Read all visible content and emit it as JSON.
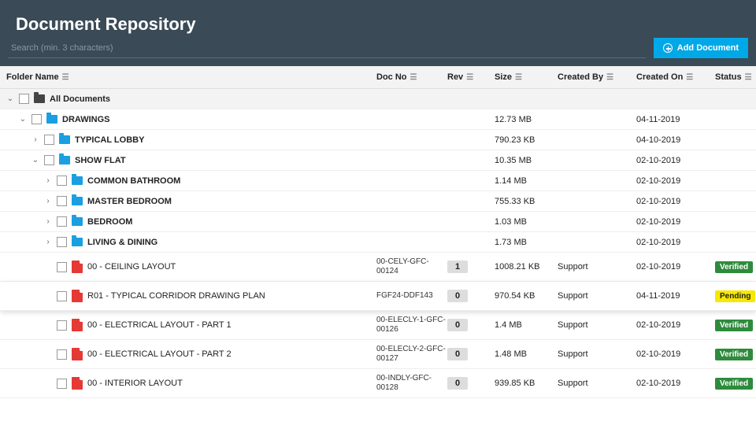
{
  "header": {
    "title": "Document Repository"
  },
  "search": {
    "placeholder": "Search (min. 3 characters)"
  },
  "buttons": {
    "add": "Add Document"
  },
  "columns": {
    "folder": "Folder Name",
    "docno": "Doc No",
    "rev": "Rev",
    "size": "Size",
    "createdby": "Created By",
    "createdon": "Created On",
    "status": "Status"
  },
  "rows": [
    {
      "type": "folder",
      "indent": 0,
      "chev": "v",
      "iconColor": "black",
      "name": "All Documents",
      "top": true
    },
    {
      "type": "folder",
      "indent": 1,
      "chev": "v",
      "iconColor": "blue",
      "name": "DRAWINGS",
      "size": "12.73 MB",
      "createdon": "04-11-2019"
    },
    {
      "type": "folder",
      "indent": 2,
      "chev": ">",
      "iconColor": "blue",
      "name": "TYPICAL LOBBY",
      "size": "790.23 KB",
      "createdon": "04-10-2019"
    },
    {
      "type": "folder",
      "indent": 2,
      "chev": "v",
      "iconColor": "blue",
      "name": "SHOW FLAT",
      "size": "10.35 MB",
      "createdon": "02-10-2019"
    },
    {
      "type": "folder",
      "indent": 3,
      "chev": ">",
      "iconColor": "blue",
      "name": "COMMON BATHROOM",
      "size": "1.14 MB",
      "createdon": "02-10-2019"
    },
    {
      "type": "folder",
      "indent": 3,
      "chev": ">",
      "iconColor": "blue",
      "name": "MASTER BEDROOM",
      "size": "755.33 KB",
      "createdon": "02-10-2019"
    },
    {
      "type": "folder",
      "indent": 3,
      "chev": ">",
      "iconColor": "blue",
      "name": "BEDROOM",
      "size": "1.03 MB",
      "createdon": "02-10-2019"
    },
    {
      "type": "folder",
      "indent": 3,
      "chev": ">",
      "iconColor": "blue",
      "name": "LIVING & DINING",
      "size": "1.73 MB",
      "createdon": "02-10-2019"
    },
    {
      "type": "doc",
      "indent": 3,
      "name": "00 - CEILING LAYOUT",
      "docno": "00-CELY-GFC-00124",
      "rev": "1",
      "size": "1008.21 KB",
      "createdby": "Support",
      "createdon": "02-10-2019",
      "status": "Verified",
      "statusClass": "verified"
    },
    {
      "type": "doc",
      "indent": 3,
      "name": "R01 - TYPICAL CORRIDOR DRAWING PLAN",
      "docno": "FGF24-DDF143",
      "rev": "0",
      "size": "970.54 KB",
      "createdby": "Support",
      "createdon": "04-11-2019",
      "status": "Pending",
      "statusClass": "pending",
      "highlight": true
    },
    {
      "type": "doc",
      "indent": 3,
      "name": "00 - ELECTRICAL LAYOUT - PART 1",
      "docno": "00-ELECLY-1-GFC-00126",
      "rev": "0",
      "size": "1.4 MB",
      "createdby": "Support",
      "createdon": "02-10-2019",
      "status": "Verified",
      "statusClass": "verified"
    },
    {
      "type": "doc",
      "indent": 3,
      "name": "00 - ELECTRICAL LAYOUT - PART 2",
      "docno": "00-ELECLY-2-GFC-00127",
      "rev": "0",
      "size": "1.48 MB",
      "createdby": "Support",
      "createdon": "02-10-2019",
      "status": "Verified",
      "statusClass": "verified"
    },
    {
      "type": "doc",
      "indent": 3,
      "name": "00 - INTERIOR LAYOUT",
      "docno": "00-INDLY-GFC-00128",
      "rev": "0",
      "size": "939.85 KB",
      "createdby": "Support",
      "createdon": "02-10-2019",
      "status": "Verified",
      "statusClass": "verified"
    }
  ]
}
